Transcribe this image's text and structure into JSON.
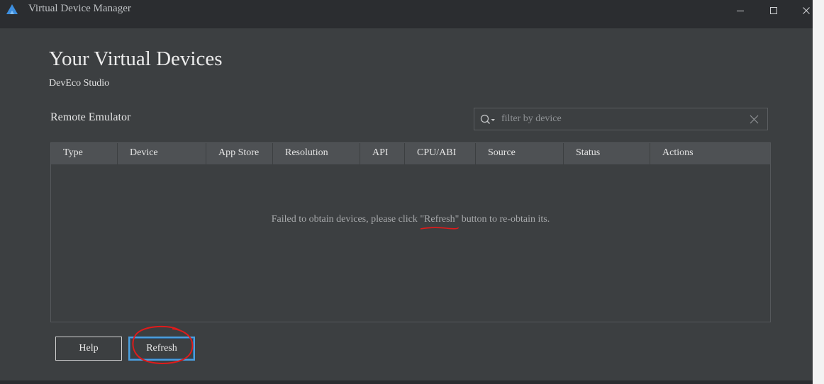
{
  "window": {
    "title": "Virtual Device Manager",
    "icon": "deveco-logo-icon",
    "controls": [
      "minimize-icon",
      "maximize-icon",
      "close-icon"
    ]
  },
  "header": {
    "title": "Your Virtual Devices",
    "subtitle": "DevEco Studio"
  },
  "section": {
    "label": "Remote Emulator"
  },
  "search": {
    "placeholder": "filter by device",
    "value": "",
    "icon": "search-icon",
    "clear_icon": "close-icon"
  },
  "table": {
    "columns": [
      "Type",
      "Device",
      "App Store",
      "Resolution",
      "API",
      "CPU/ABI",
      "Source",
      "Status",
      "Actions"
    ],
    "rows": [],
    "empty_message": {
      "before": "Failed to obtain devices, please click ",
      "highlight": "\"Refresh\"",
      "after": " button to re-obtain its."
    }
  },
  "buttons": {
    "help_label": "Help",
    "refresh_label": "Refresh"
  },
  "colors": {
    "background": "#3c3f41",
    "titlebar": "#2b2d30",
    "table_header": "#4e5154",
    "focus_border": "#4a9ede",
    "annotation_red": "#e01b1b"
  }
}
